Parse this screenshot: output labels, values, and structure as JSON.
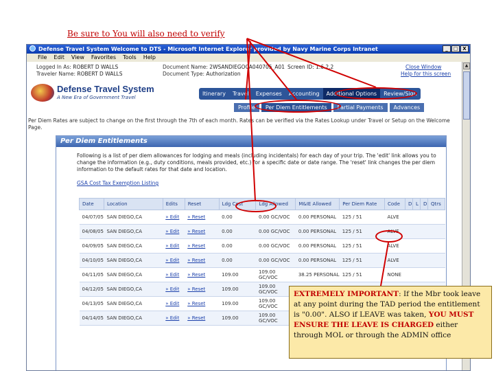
{
  "slide": {
    "caption": "Be sure to You will also need to verify"
  },
  "window": {
    "title": "Defense Travel System Welcome to DTS - Microsoft Internet Explorer provided by Navy Marine Corps Intranet",
    "buttons": [
      "_",
      "□",
      "X"
    ],
    "menu": [
      "File",
      "Edit",
      "View",
      "Favorites",
      "Tools",
      "Help"
    ]
  },
  "header": {
    "logged_in_as_label": "Logged In As:",
    "logged_in_as_value": "ROBERT D WALLS",
    "traveler_label": "Traveler Name:",
    "traveler_value": "ROBERT D WALLS",
    "document_name_label": "Document Name:",
    "document_name_value": "2WSANDIEGOCA040705_A01",
    "document_type_label": "Document Type:",
    "document_type_value": "Authorization",
    "screen_id": "Screen ID: 1.6.2.2",
    "close_window": "Close Window",
    "help": "Help for this screen"
  },
  "logo": {
    "title": "Defense Travel System",
    "subtitle": "A New Era of Government Travel"
  },
  "main_tabs": [
    "Itinerary",
    "Travel",
    "Expenses",
    "Accounting",
    "Additional Options",
    "Review/Sign"
  ],
  "sub_tabs": [
    "Profile",
    "Per Diem Entitlements",
    "Partial Payments",
    "Advances"
  ],
  "notice": "Per Diem Rates are subject to change on the first through the 7th of each month. Rates can be verified via the Rates Lookup under Travel or Setup on the Welcome Page.",
  "panel": {
    "title": "Per Diem Entitlements",
    "description": "Following is a list of per diem allowances for lodging and meals (including incidentals) for each day of your trip. The 'edit' link allows you to change the information (e.g., duty conditions, meals provided, etc.) for a specific date or date range. The 'reset' link changes the per diem information to the default rates for that date and location.",
    "link": "GSA Cost Tax Exemption Listing"
  },
  "table": {
    "headers": [
      "Date",
      "Location",
      "Edits",
      "Reset",
      "Ldg Cost",
      "Ldg Allowed",
      "M&IE Allowed",
      "Per Diem Rate",
      "Code",
      "D",
      "L",
      "D",
      "Qtrs"
    ],
    "rows": [
      {
        "date": "04/07/05",
        "location": "SAN DIEGO,CA",
        "edit": "» Edit",
        "reset": "» Reset",
        "ldg_cost": "0.00",
        "ldg_allowed": "0.00 GC/VOC",
        "mie_allowed": "0.00 PERSONAL",
        "rate": "125 / 51",
        "code": "ALVE"
      },
      {
        "date": "04/08/05",
        "location": "SAN DIEGO,CA",
        "edit": "» Edit",
        "reset": "» Reset",
        "ldg_cost": "0.00",
        "ldg_allowed": "0.00 GC/VOC",
        "mie_allowed": "0.00 PERSONAL",
        "rate": "125 / 51",
        "code": "ALVE"
      },
      {
        "date": "04/09/05",
        "location": "SAN DIEGO,CA",
        "edit": "» Edit",
        "reset": "» Reset",
        "ldg_cost": "0.00",
        "ldg_allowed": "0.00 GC/VOC",
        "mie_allowed": "0.00 PERSONAL",
        "rate": "125 / 51",
        "code": "ALVE"
      },
      {
        "date": "04/10/05",
        "location": "SAN DIEGO,CA",
        "edit": "» Edit",
        "reset": "» Reset",
        "ldg_cost": "0.00",
        "ldg_allowed": "0.00 GC/VOC",
        "mie_allowed": "0.00 PERSONAL",
        "rate": "125 / 51",
        "code": "ALVE"
      },
      {
        "date": "04/11/05",
        "location": "SAN DIEGO,CA",
        "edit": "» Edit",
        "reset": "» Reset",
        "ldg_cost": "109.00",
        "ldg_allowed": "109.00 GC/VOC",
        "mie_allowed": "38.25 PERSONAL",
        "rate": "125 / 51",
        "code": "NONE"
      },
      {
        "date": "04/12/05",
        "location": "SAN DIEGO,CA",
        "edit": "» Edit",
        "reset": "» Reset",
        "ldg_cost": "109.00",
        "ldg_allowed": "109.00 GC/VOC",
        "mie_allowed": "",
        "rate": "",
        "code": ""
      },
      {
        "date": "04/13/05",
        "location": "SAN DIEGO,CA",
        "edit": "» Edit",
        "reset": "» Reset",
        "ldg_cost": "109.00",
        "ldg_allowed": "109.00 GC/VOC",
        "mie_allowed": "",
        "rate": "",
        "code": ""
      },
      {
        "date": "04/14/05",
        "location": "SAN DIEGO,CA",
        "edit": "» Edit",
        "reset": "» Reset",
        "ldg_cost": "109.00",
        "ldg_allowed": "109.00 GC/VOC",
        "mie_allowed": "",
        "rate": "",
        "code": ""
      }
    ]
  },
  "callout": {
    "lead": "EXTREMELY IMPORTANT",
    "text1": ": If the Mbr took leave at any point during the TAD period the entitlement is \"0.00\".  ALSO if LEAVE was taken, ",
    "emphasis": "YOU MUST ENSURE THE LEAVE IS CHARGED",
    "text2": " either through MOL or through the ADMIN office"
  },
  "colors": {
    "annotation": "#d00000",
    "dts_blue": "#1f3f87",
    "callout_bg": "#fce9a8"
  }
}
